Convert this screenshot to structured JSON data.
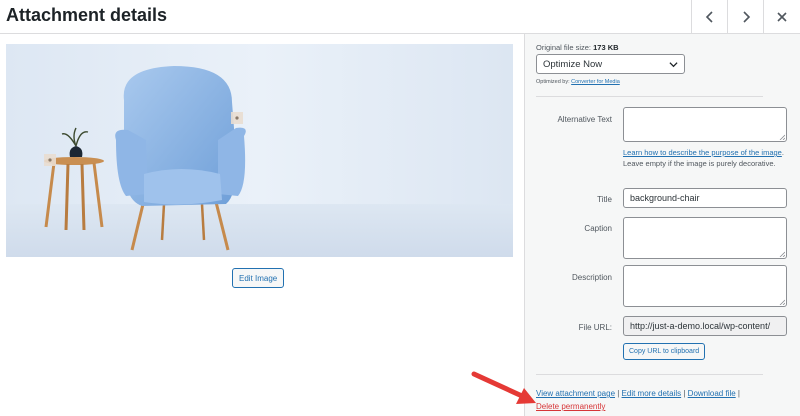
{
  "header": {
    "title": "Attachment details",
    "prev_icon": "chevron-left-icon",
    "next_icon": "chevron-right-icon",
    "close_icon": "close-icon"
  },
  "media": {
    "image_description": "light blue armchair beside a wooden side table with a small potted plant",
    "edit_image_label": "Edit Image"
  },
  "details": {
    "original_size_label": "Original file size:",
    "original_size_value": "173 KB",
    "optimize_select_value": "Optimize Now",
    "optimized_by_label": "Optimized by:",
    "optimized_by_link": "Converter for Media",
    "fields": {
      "alt_text_label": "Alternative Text",
      "alt_text_value": "",
      "help_link": "Learn how to describe the purpose of the image",
      "help_rest": ". Leave empty if the image is purely decorative.",
      "title_label": "Title",
      "title_value": "background-chair",
      "caption_label": "Caption",
      "caption_value": "",
      "description_label": "Description",
      "description_value": "",
      "file_url_label": "File URL:",
      "file_url_value": "http://just-a-demo.local/wp-content/",
      "copy_url_label": "Copy URL to clipboard"
    }
  },
  "actions": {
    "view_page": "View attachment page",
    "edit_more": "Edit more details",
    "download": "Download file",
    "separator": " | ",
    "delete": "Delete permanently"
  },
  "colors": {
    "link": "#2271b1",
    "danger": "#d63638",
    "annotation_arrow": "#e53935",
    "panel_bg": "#f6f7f7"
  }
}
